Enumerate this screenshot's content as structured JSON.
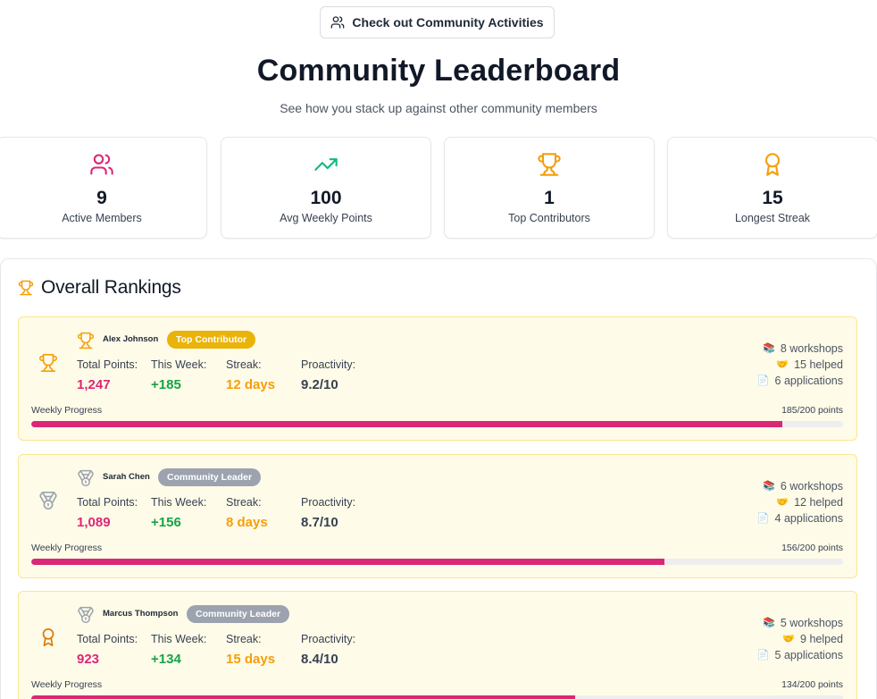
{
  "top_button": {
    "label": "Check out Community Activities",
    "icon": "users-icon"
  },
  "header": {
    "title": "Community Leaderboard",
    "subtitle": "See how you stack up against other community members"
  },
  "stats": [
    {
      "value": "9",
      "label": "Active Members",
      "icon": "users-icon",
      "color": "#db2777"
    },
    {
      "value": "100",
      "label": "Avg Weekly Points",
      "icon": "trending-up-icon",
      "color": "#10b981"
    },
    {
      "value": "1",
      "label": "Top Contributors",
      "icon": "trophy-icon",
      "color": "#f59e0b"
    },
    {
      "value": "15",
      "label": "Longest Streak",
      "icon": "award-icon",
      "color": "#f59e0b"
    }
  ],
  "rankings": {
    "title": "Overall Rankings",
    "column_labels": {
      "total": "Total Points:",
      "week": "This Week:",
      "streak": "Streak:",
      "proactivity": "Proactivity:"
    },
    "progress_label": "Weekly Progress",
    "members": [
      {
        "name": "Alex Johnson",
        "badge": "Top Contributor",
        "badge_color": "#eab308",
        "total": "1,247",
        "week": "+185",
        "streak": "12 days",
        "proactivity": "9.2/10",
        "workshops": "8 workshops",
        "helped": "15 helped",
        "applications": "6 applications",
        "progress_text": "185/200 points",
        "progress": 0.925
      },
      {
        "name": "Sarah Chen",
        "badge": "Community Leader",
        "badge_color": "#9ca3af",
        "total": "1,089",
        "week": "+156",
        "streak": "8 days",
        "proactivity": "8.7/10",
        "workshops": "6 workshops",
        "helped": "12 helped",
        "applications": "4 applications",
        "progress_text": "156/200 points",
        "progress": 0.78
      },
      {
        "name": "Marcus Thompson",
        "badge": "Community Leader",
        "badge_color": "#9ca3af",
        "total": "923",
        "week": "+134",
        "streak": "15 days",
        "proactivity": "8.4/10",
        "workshops": "5 workshops",
        "helped": "9 helped",
        "applications": "5 applications",
        "progress_text": "134/200 points",
        "progress": 0.67
      }
    ]
  }
}
